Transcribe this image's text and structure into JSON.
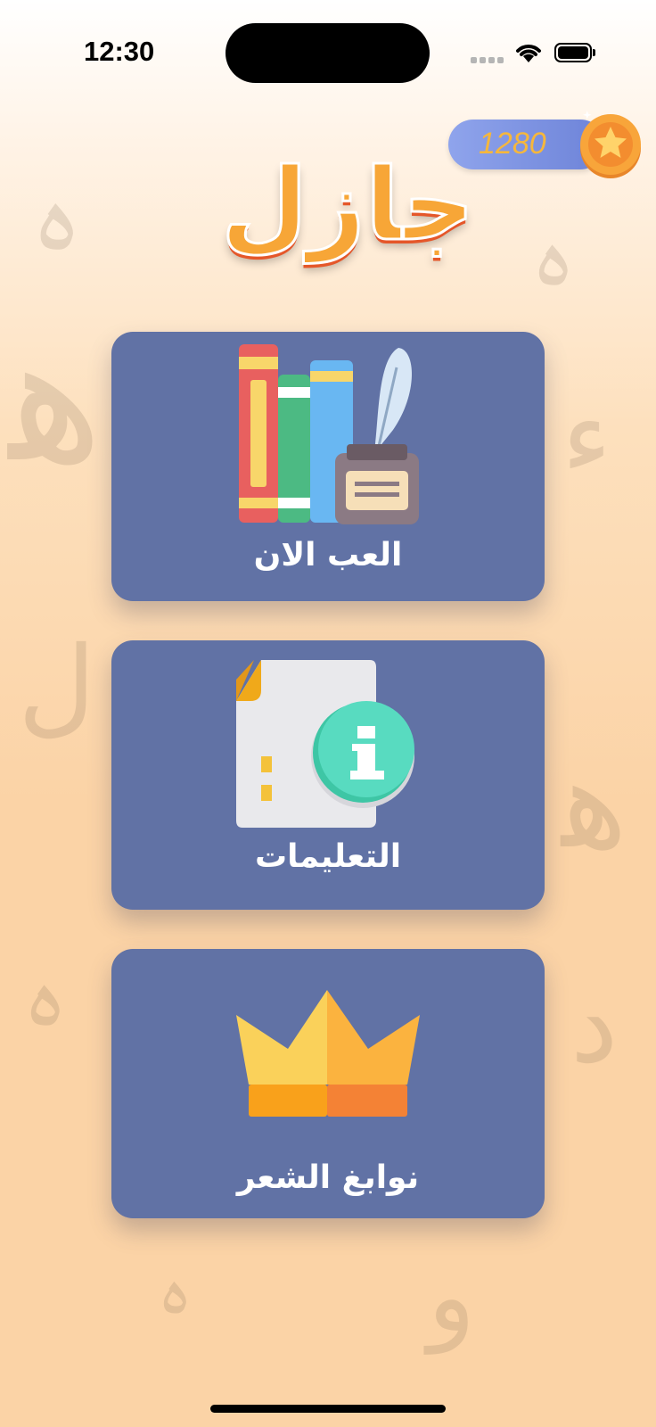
{
  "status_bar": {
    "time": "12:30"
  },
  "header": {
    "coins": "1280",
    "logo_text": "جازل"
  },
  "menu": [
    {
      "label": "العب الان",
      "icon": "books-quill-icon"
    },
    {
      "label": "التعليمات",
      "icon": "info-document-icon"
    },
    {
      "label": "نوابغ الشعر",
      "icon": "crown-icon"
    }
  ],
  "colors": {
    "card": "#6172a5",
    "coin_badge": "#7b8fe0",
    "coin_text": "#f6b73c",
    "logo_fill": "#f7a637",
    "background_bottom": "#fbd3a6"
  }
}
